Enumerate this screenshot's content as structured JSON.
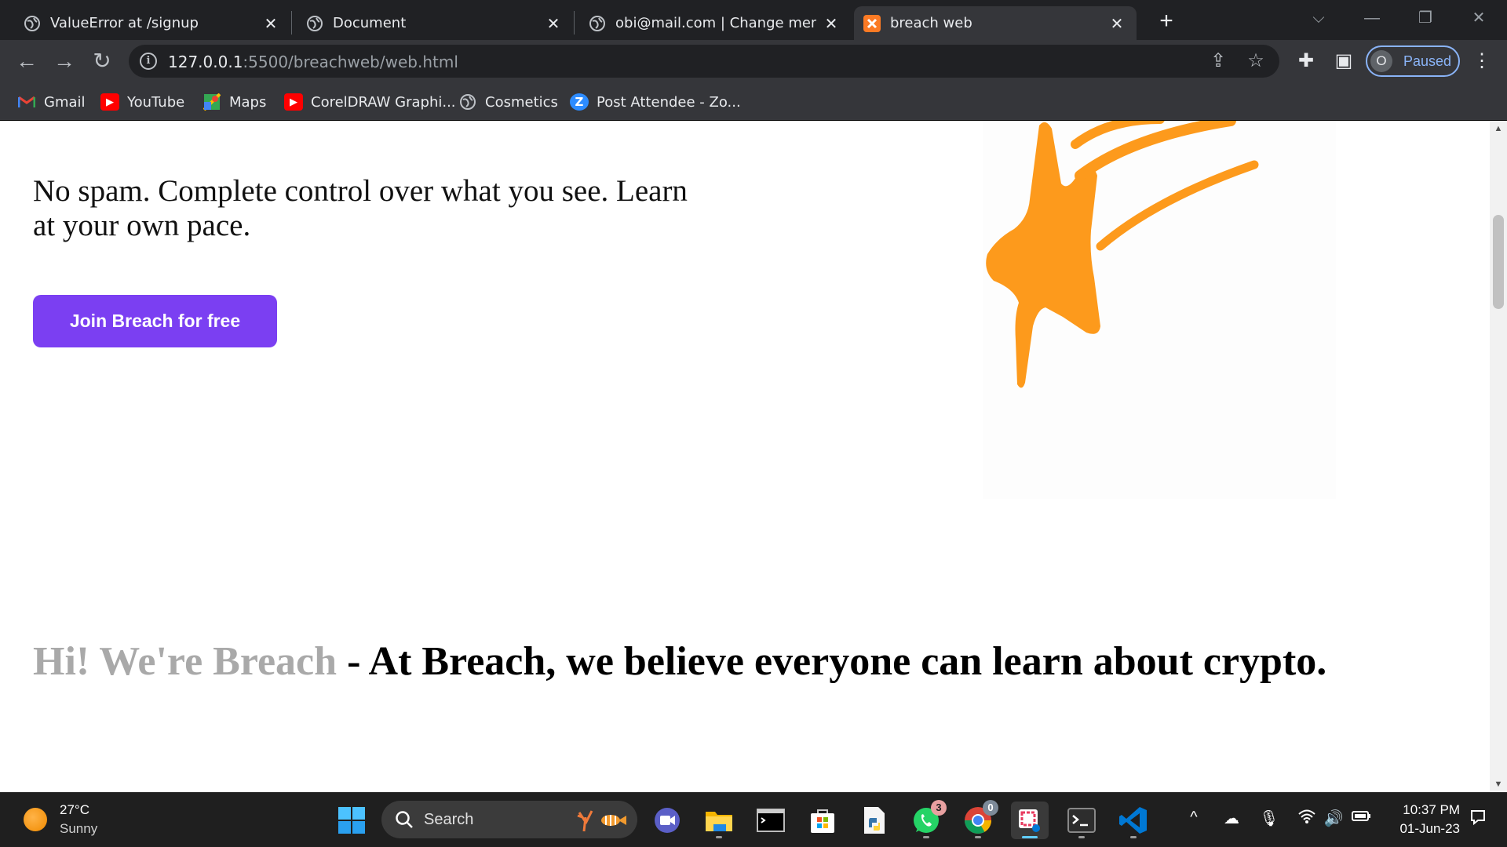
{
  "browser": {
    "tabs": [
      {
        "title": "ValueError at /signup",
        "active": false
      },
      {
        "title": "Document",
        "active": false
      },
      {
        "title": "obi@mail.com | Change member",
        "active": false
      },
      {
        "title": "breach web",
        "active": true
      }
    ],
    "url_host": "127.0.0.1",
    "url_rest": ":5500/breachweb/web.html",
    "profile_initial": "O",
    "profile_status": "Paused",
    "bookmarks": [
      {
        "label": "Gmail",
        "icon": "gmail-icon"
      },
      {
        "label": "YouTube",
        "icon": "youtube-icon"
      },
      {
        "label": "Maps",
        "icon": "maps-icon"
      },
      {
        "label": "CorelDRAW Graphi...",
        "icon": "youtube-icon"
      },
      {
        "label": "Cosmetics",
        "icon": "globe-icon"
      },
      {
        "label": "Post Attendee - Zo...",
        "icon": "zoom-icon"
      }
    ]
  },
  "page": {
    "lead": "No spam. Complete control over what you see. Learn at your own pace.",
    "cta_label": "Join Breach for free",
    "headline_muted": "Hi! We're Breach",
    "headline_main": " - At Breach, we believe everyone can learn about crypto.",
    "accent_color": "#7b3ff2",
    "star_color": "#fd9a1c"
  },
  "taskbar": {
    "temperature": "27°C",
    "condition": "Sunny",
    "search_label": "Search",
    "whatsapp_badge": "3",
    "chrome_badge": "0",
    "time": "10:37 PM",
    "date": "01-Jun-23"
  }
}
